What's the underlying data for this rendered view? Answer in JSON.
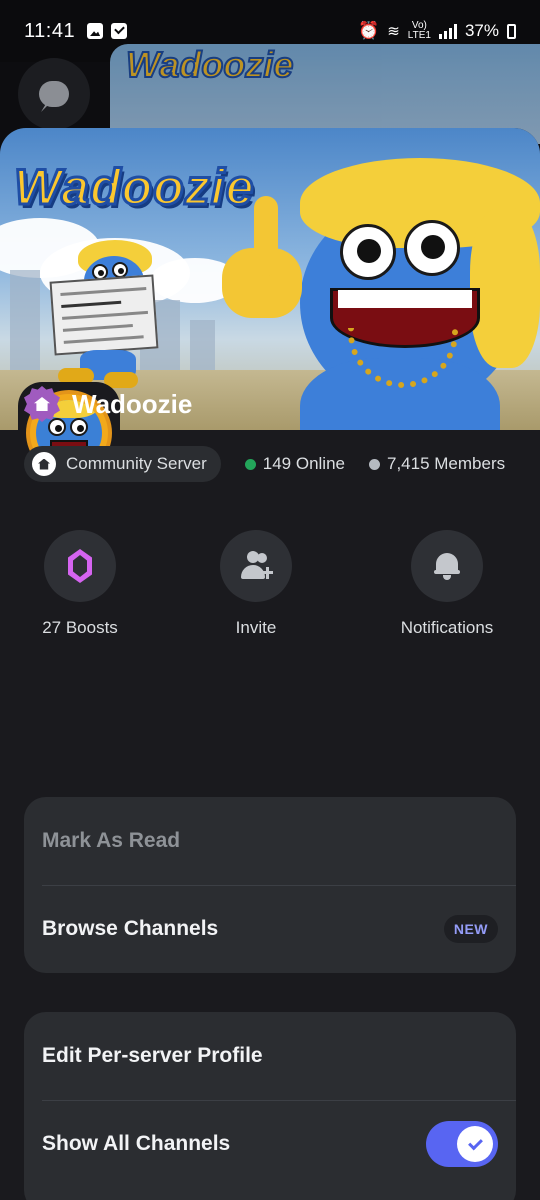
{
  "status_bar": {
    "time": "11:41",
    "network_top": "Vo)",
    "network_bottom": "LTE1",
    "battery": "37%"
  },
  "server": {
    "banner_title": "Wadoozie",
    "name": "Wadoozie",
    "community_label": "Community Server",
    "online": "149 Online",
    "members": "7,415 Members",
    "online_color": "#23a55a",
    "members_color": "#b5bac1"
  },
  "actions": [
    {
      "label": "27 Boosts",
      "icon": "boost-icon"
    },
    {
      "label": "Invite",
      "icon": "invite-icon"
    },
    {
      "label": "Notifications",
      "icon": "bell-icon"
    }
  ],
  "menu_group_1": {
    "mark_as_read": "Mark As Read",
    "browse_channels": "Browse Channels",
    "new_badge": "NEW"
  },
  "menu_group_2": {
    "edit_profile": "Edit Per-server Profile",
    "show_all_channels": "Show All Channels",
    "show_all_channels_enabled": true
  },
  "colors": {
    "accent": "#5865f2",
    "boost": "#d564f0",
    "home_badge": "#a05bbf"
  }
}
